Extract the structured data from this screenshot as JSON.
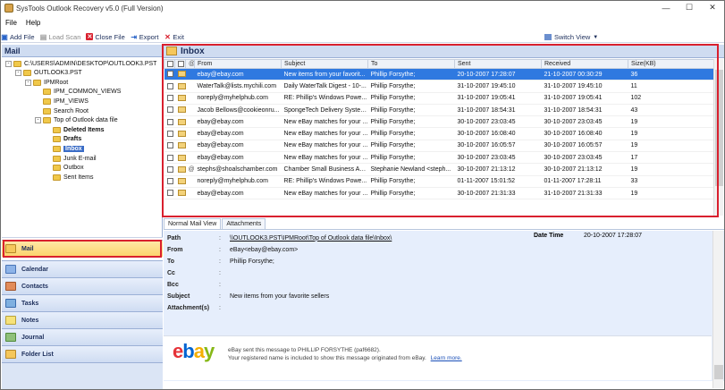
{
  "window": {
    "title": "SysTools Outlook Recovery v5.0 (Full Version)",
    "minimize": "—",
    "maximize": "☐",
    "close": "✕"
  },
  "menu": [
    "File",
    "Help"
  ],
  "toolbar": {
    "add_file": "Add File",
    "load_scan": "Load Scan",
    "close_file": "Close File",
    "export": "Export",
    "exit": "Exit",
    "switch_view": "Switch View"
  },
  "left": {
    "header": "Mail",
    "tree": [
      {
        "label": "C:\\USERS\\ADMIN\\DESKTOP\\OUTLOOK3.PST",
        "level": 0,
        "exp": "-"
      },
      {
        "label": "OUTLOOK3.PST",
        "level": 1,
        "exp": "-"
      },
      {
        "label": "IPMRoot",
        "level": 2,
        "exp": "-"
      },
      {
        "label": "IPM_COMMON_VIEWS",
        "level": 3,
        "exp": ""
      },
      {
        "label": "IPM_VIEWS",
        "level": 3,
        "exp": ""
      },
      {
        "label": "Search Root",
        "level": 3,
        "exp": ""
      },
      {
        "label": "Top of Outlook data file",
        "level": 3,
        "exp": "-"
      },
      {
        "label": "Deleted Items",
        "level": 4,
        "exp": "",
        "bold": true
      },
      {
        "label": "Drafts",
        "level": 4,
        "exp": "",
        "bold": true
      },
      {
        "label": "Inbox",
        "level": 4,
        "exp": "",
        "bold": true,
        "selected": true
      },
      {
        "label": "Junk E-mail",
        "level": 4,
        "exp": ""
      },
      {
        "label": "Outbox",
        "level": 4,
        "exp": ""
      },
      {
        "label": "Sent Items",
        "level": 4,
        "exp": ""
      }
    ],
    "nav": [
      "Mail",
      "Calendar",
      "Contacts",
      "Tasks",
      "Notes",
      "Journal",
      "Folder List"
    ]
  },
  "inbox": {
    "title": "Inbox",
    "columns": [
      "From",
      "Subject",
      "To",
      "Sent",
      "Received",
      "Size(KB)"
    ],
    "rows": [
      {
        "from": "ebay@ebay.com",
        "subject": "New items from your favorit...",
        "to": "Phillip Forsythe;",
        "sent": "20-10-2007 17:28:07",
        "received": "21-10-2007 00:30:29",
        "size": "36",
        "attach": false,
        "selected": true
      },
      {
        "from": "WaterTalk@lists.mychili.com",
        "subject": "Daily WaterTalk Digest - 10-...",
        "to": "Phillip Forsythe;",
        "sent": "31-10-2007 19:45:10",
        "received": "31-10-2007 19:45:10",
        "size": "11",
        "attach": false
      },
      {
        "from": "noreply@myhelphub.com",
        "subject": "RE: Phillip's Windows Powe...",
        "to": "Phillip Forsythe;",
        "sent": "31-10-2007 19:05:41",
        "received": "31-10-2007 19:05:41",
        "size": "102",
        "attach": false
      },
      {
        "from": "Jacob Bellows@cookieonru...",
        "subject": "SpongeTech Delivery System...",
        "to": "Phillip Forsythe;",
        "sent": "31-10-2007 18:54:31",
        "received": "31-10-2007 18:54:31",
        "size": "43",
        "attach": false
      },
      {
        "from": "ebay@ebay.com",
        "subject": "New eBay matches for your ...",
        "to": "Phillip Forsythe;",
        "sent": "30-10-2007 23:03:45",
        "received": "30-10-2007 23:03:45",
        "size": "19",
        "attach": false
      },
      {
        "from": "ebay@ebay.com",
        "subject": "New eBay matches for your ...",
        "to": "Phillip Forsythe;",
        "sent": "30-10-2007 16:08:40",
        "received": "30-10-2007 16:08:40",
        "size": "19",
        "attach": false
      },
      {
        "from": "ebay@ebay.com",
        "subject": "New eBay matches for your ...",
        "to": "Phillip Forsythe;",
        "sent": "30-10-2007 16:05:57",
        "received": "30-10-2007 16:05:57",
        "size": "19",
        "attach": false
      },
      {
        "from": "ebay@ebay.com",
        "subject": "New eBay matches for your ...",
        "to": "Phillip Forsythe;",
        "sent": "30-10-2007 23:03:45",
        "received": "30-10-2007 23:03:45",
        "size": "17",
        "attach": false
      },
      {
        "from": "stephs@shoalschamber.com",
        "subject": "Chamber Small Business Aw...",
        "to": "Stephanie Newland <steph...",
        "sent": "30-10-2007 21:13:12",
        "received": "30-10-2007 21:13:12",
        "size": "19",
        "attach": true
      },
      {
        "from": "noreply@myhelphub.com",
        "subject": "RE: Phillip's Windows Powe...",
        "to": "Phillip Forsythe;",
        "sent": "01-11-2007 15:01:52",
        "received": "01-11-2007 17:28:11",
        "size": "33",
        "attach": false
      },
      {
        "from": "ebay@ebay.com",
        "subject": "New eBay matches for your ...",
        "to": "Phillip Forsythe;",
        "sent": "30-10-2007 21:31:33",
        "received": "31-10-2007 21:31:33",
        "size": "19",
        "attach": false
      }
    ]
  },
  "tabs": [
    "Normal Mail View",
    "Attachments"
  ],
  "detail": {
    "path_label": "Path",
    "path_value": "\\\\OUTLOOK3.PST\\IPMRoot\\Top of Outlook data file\\Inbox\\",
    "datetime_label": "Date Time",
    "datetime_value": "20-10-2007 17:28:07",
    "from_label": "From",
    "from_value": "eBay<ebay@ebay.com>",
    "to_label": "To",
    "to_value": "Phillip Forsythe;",
    "cc_label": "Cc",
    "bcc_label": "Bcc",
    "subject_label": "Subject",
    "subject_value": "New items from your favorite sellers",
    "attach_label": "Attachment(s)",
    "colon": ":",
    "ebay_note1": "eBay sent this message to PHILLIP FORSYTHE (paf6682).",
    "ebay_note2": "Your registered name is included to show this message originated from eBay.",
    "learn_more": "Learn more."
  },
  "colors": {
    "accent": "#2f79e0",
    "header_bg": "#cfdcf1",
    "highlight_box": "#d9202e",
    "detail_bg": "#e6eefc"
  }
}
